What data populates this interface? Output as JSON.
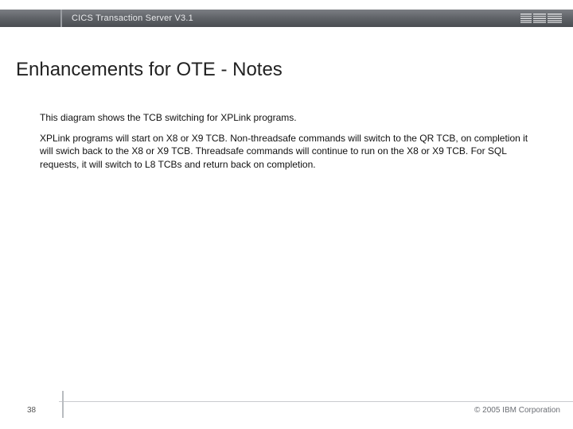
{
  "header": {
    "title": "CICS Transaction Server V3.1",
    "logo_name": "ibm-logo"
  },
  "slide": {
    "title": "Enhancements for OTE - Notes"
  },
  "body": {
    "p1": "This diagram shows the TCB switching for XPLink programs.",
    "p2": "XPLink programs will start on X8 or X9 TCB. Non-threadsafe commands will switch to the QR TCB, on completion it will swich back to the X8 or X9 TCB. Threadsafe commands will continue to run on the X8 or X9 TCB. For SQL requests, it will switch to L8 TCBs and return back on completion."
  },
  "footer": {
    "page": "38",
    "copyright": "© 2005 IBM Corporation"
  }
}
